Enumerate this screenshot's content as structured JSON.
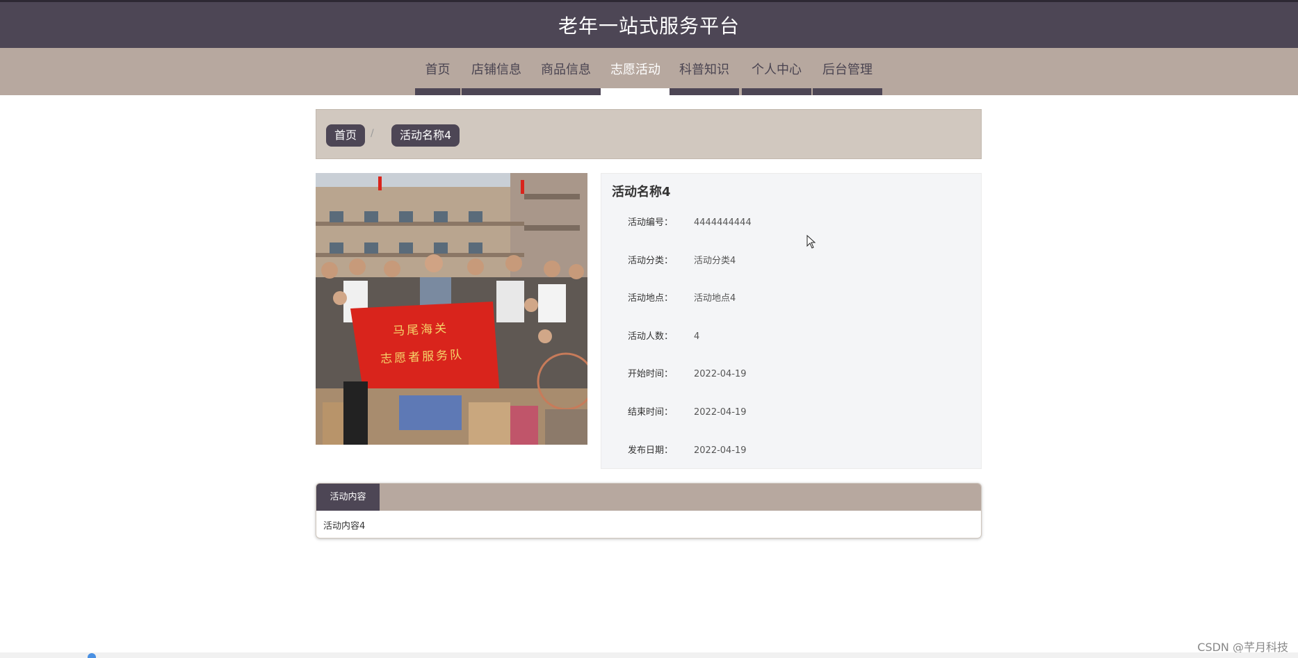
{
  "header": {
    "title": "老年一站式服务平台"
  },
  "nav": {
    "items": [
      {
        "label": "首页",
        "active": false
      },
      {
        "label": "店铺信息",
        "active": false
      },
      {
        "label": "商品信息",
        "active": false
      },
      {
        "label": "志愿活动",
        "active": true
      },
      {
        "label": "科普知识",
        "active": false
      },
      {
        "label": "个人中心",
        "active": false
      },
      {
        "label": "后台管理",
        "active": false
      }
    ]
  },
  "breadcrumb": {
    "home": "首页",
    "separator": "/",
    "current": "活动名称4"
  },
  "activity": {
    "name": "活动名称4",
    "image_alt": "volunteer-group-photo",
    "banner_line1": "马尾海关",
    "banner_line2": "志愿者服务队",
    "fields": [
      {
        "label": "活动编号：",
        "value": "4444444444"
      },
      {
        "label": "活动分类：",
        "value": "活动分类4"
      },
      {
        "label": "活动地点：",
        "value": "活动地点4"
      },
      {
        "label": "活动人数：",
        "value": "4"
      },
      {
        "label": "开始时间：",
        "value": "2022-04-19"
      },
      {
        "label": "结束时间：",
        "value": "2022-04-19"
      },
      {
        "label": "发布日期：",
        "value": "2022-04-19"
      }
    ]
  },
  "content_tab": {
    "label": "活动内容",
    "body": "活动内容4"
  },
  "watermark": "CSDN @芊月科技",
  "colors": {
    "header_bg": "#4d4655",
    "nav_bg": "#b7a89f",
    "breadcrumb_bg": "#d1c8bf",
    "panel_bg": "#f4f5f7",
    "banner_red": "#d9241c"
  }
}
